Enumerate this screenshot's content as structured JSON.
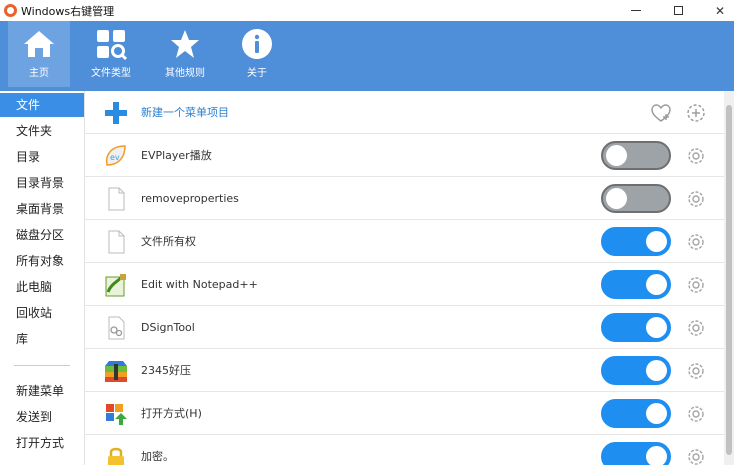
{
  "window": {
    "title": "Windows右键管理"
  },
  "toolbar": {
    "items": [
      {
        "label": "主页",
        "icon": "home-icon"
      },
      {
        "label": "文件类型",
        "icon": "file-type-icon"
      },
      {
        "label": "其他规则",
        "icon": "star-icon"
      },
      {
        "label": "关于",
        "icon": "info-icon"
      }
    ],
    "active": "主页"
  },
  "sidebar": {
    "items": [
      {
        "label": "文件"
      },
      {
        "label": "文件夹"
      },
      {
        "label": "目录"
      },
      {
        "label": "目录背景"
      },
      {
        "label": "桌面背景"
      },
      {
        "label": "磁盘分区"
      },
      {
        "label": "所有对象"
      },
      {
        "label": "此电脑"
      },
      {
        "label": "回收站"
      },
      {
        "label": "库"
      },
      {
        "label": "新建菜单"
      },
      {
        "label": "发送到"
      },
      {
        "label": "打开方式"
      }
    ],
    "active": "文件"
  },
  "content": {
    "new_item_label": "新建一个菜单项目",
    "rows": [
      {
        "label": "EVPlayer播放",
        "icon": "evplayer-icon",
        "enabled": false
      },
      {
        "label": "removeproperties",
        "icon": "blank-file-icon",
        "enabled": false
      },
      {
        "label": "文件所有权",
        "icon": "blank-file-icon",
        "enabled": true
      },
      {
        "label": "Edit with Notepad++",
        "icon": "notepad-plus-plus-icon",
        "enabled": true
      },
      {
        "label": "DSignTool",
        "icon": "dsigntool-icon",
        "enabled": true
      },
      {
        "label": "2345好压",
        "icon": "2345-archive-icon",
        "enabled": true
      },
      {
        "label": "打开方式(H)",
        "icon": "open-with-icon",
        "enabled": true
      },
      {
        "label": "加密。",
        "icon": "lock-icon",
        "enabled": true
      }
    ]
  },
  "colors": {
    "toolbar_bg": "#4f8ed9",
    "toggle_on": "#1e8ef0",
    "toggle_off": "#9ea3a8",
    "sidebar_active": "#3a8ee6"
  }
}
